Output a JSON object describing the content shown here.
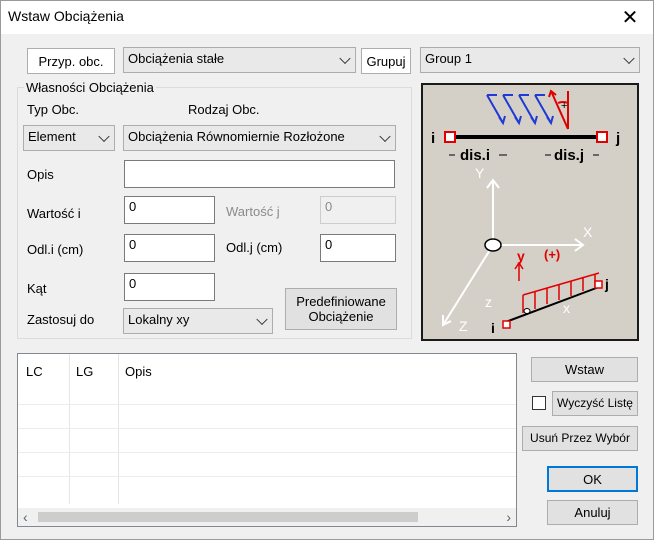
{
  "window": {
    "title": "Wstaw Obciążenia"
  },
  "top": {
    "case_tab_label": "Przyp. obc.",
    "case_combo_value": "Obciążenia stałe",
    "group_tab_label": "Grupuj",
    "group_combo_value": "Group 1"
  },
  "props": {
    "group_title": "Własności Obciążenia",
    "type_label": "Typ Obc.",
    "kind_label": "Rodzaj Obc.",
    "type_value": "Element",
    "kind_value": "Obciążenia Równomiernie Rozłożone",
    "desc_label": "Opis",
    "desc_value": "",
    "value_i_label": "Wartość i",
    "value_i": "0",
    "value_j_label": "Wartość j",
    "value_j": "0",
    "odl_i_label": "Odl.i (cm)",
    "odl_i": "0",
    "odl_j_label": "Odl.j (cm)",
    "odl_j": "0",
    "angle_label": "Kąt",
    "angle_value": "0",
    "apply_label": "Zastosuj do",
    "apply_value": "Lokalny xy",
    "predef_button": "Predefiniowane\nObciążenie"
  },
  "diagram": {
    "node_i": "i",
    "node_j": "j",
    "dis_i": "dis.i",
    "dis_j": "dis.j",
    "axis_y": "Y",
    "axis_x": "X",
    "axis_z": "Z",
    "local_y": "y",
    "local_plus": "(+)",
    "local_x": "x",
    "local_z": "z",
    "local_i": "i",
    "local_j": "j",
    "colors": {
      "blue": "#1f3ad6",
      "red": "#e00000"
    }
  },
  "list": {
    "columns": [
      "LC",
      "LG",
      "Opis"
    ],
    "rows": []
  },
  "actions": {
    "insert": "Wstaw",
    "clear_list": "Wyczyść Listę",
    "clear_list_checked": false,
    "remove_selected": "Usuń Przez Wybór",
    "ok": "OK",
    "cancel": "Anuluj"
  }
}
